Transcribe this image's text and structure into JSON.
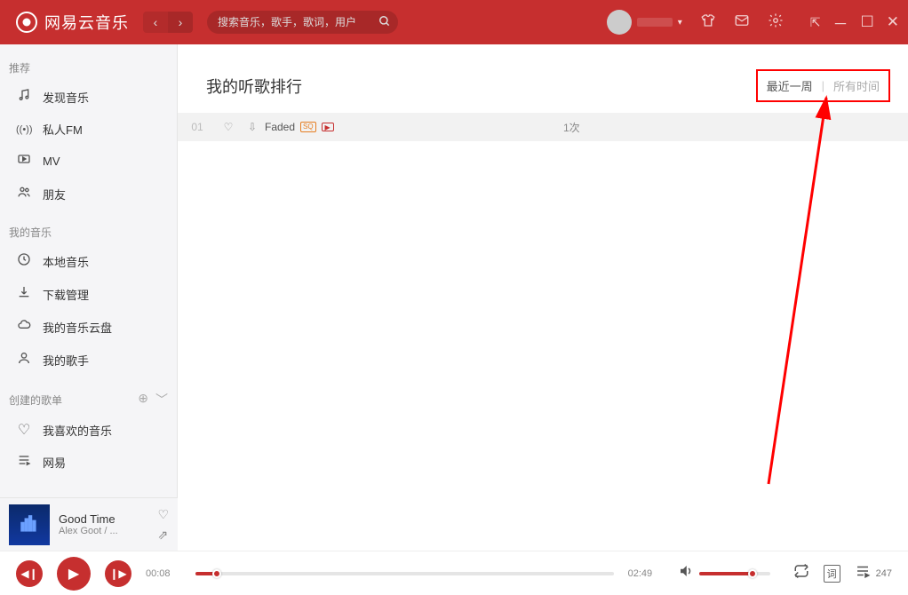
{
  "header": {
    "app_title": "网易云音乐",
    "search_placeholder": "搜索音乐，歌手，歌词，用户"
  },
  "sidebar": {
    "sections": [
      {
        "title": "推荐",
        "items": [
          {
            "icon": "♫",
            "label": "发现音乐"
          },
          {
            "icon": "((•))",
            "label": "私人FM"
          },
          {
            "icon": "▷",
            "label": "MV"
          },
          {
            "icon": "◡",
            "label": "朋友"
          }
        ]
      },
      {
        "title": "我的音乐",
        "items": [
          {
            "icon": "◔",
            "label": "本地音乐"
          },
          {
            "icon": "⇩",
            "label": "下载管理"
          },
          {
            "icon": "☁",
            "label": "我的音乐云盘"
          },
          {
            "icon": "◡",
            "label": "我的歌手"
          }
        ]
      },
      {
        "title": "创建的歌单",
        "show_add": true,
        "items": [
          {
            "icon": "♡",
            "label": "我喜欢的音乐"
          },
          {
            "icon": "≣",
            "label": "网易"
          }
        ]
      }
    ]
  },
  "now_playing": {
    "title": "Good Time",
    "artist": "Alex Goot / ..."
  },
  "main": {
    "page_title": "我的听歌排行",
    "tabs": {
      "week": "最近一周",
      "all": "所有时间"
    },
    "rows": [
      {
        "index": "01",
        "name": "Faded",
        "sq": "SQ",
        "plays": "1次"
      }
    ]
  },
  "player": {
    "current_time": "00:08",
    "total_time": "02:49",
    "queue_count": "247"
  }
}
